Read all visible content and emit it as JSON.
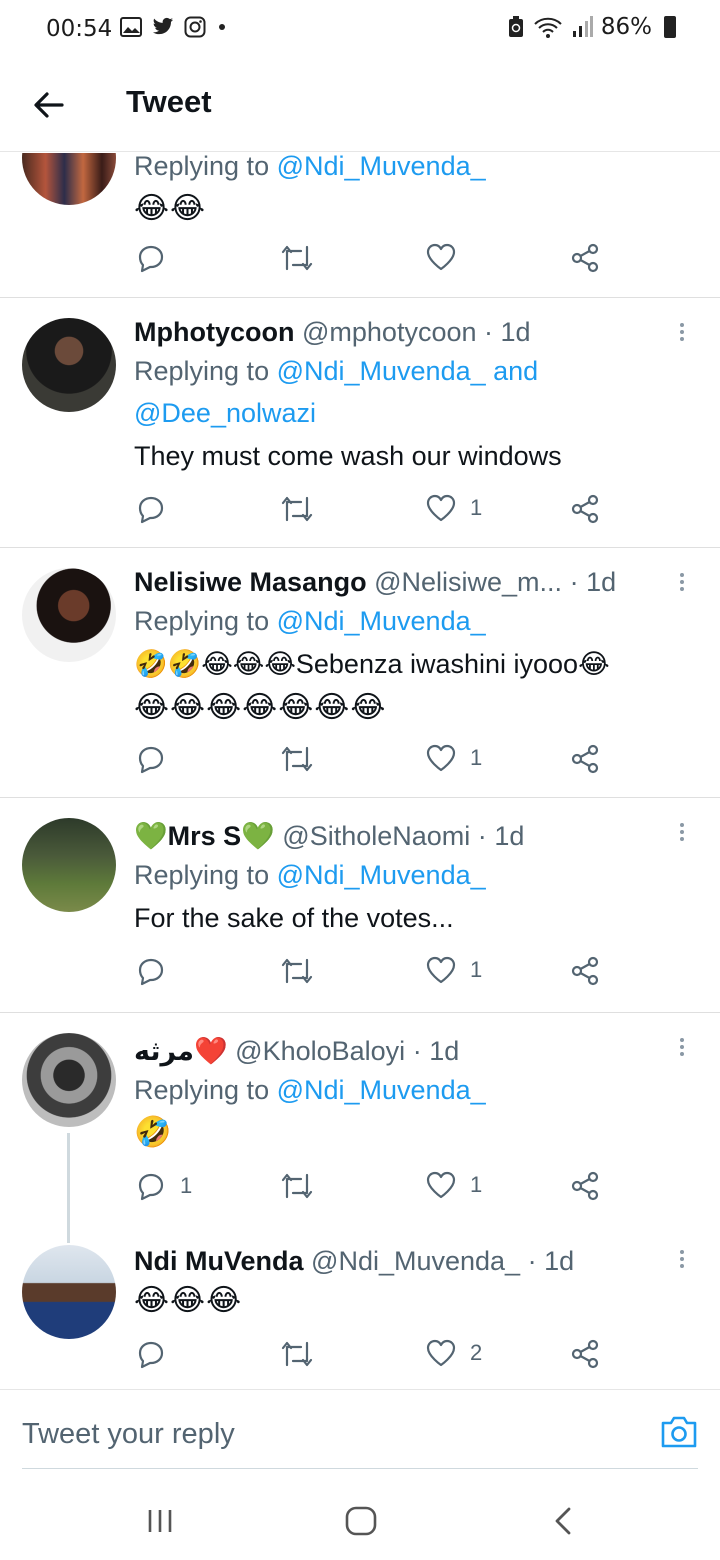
{
  "status_bar": {
    "time": "00:54",
    "battery": "86%",
    "left_icons": [
      "gallery-icon",
      "twitter-bird-icon",
      "instagram-icon",
      "dot-icon"
    ],
    "right_icons": [
      "recycle-icon",
      "wifi-icon",
      "signal-icon",
      "battery-icon"
    ]
  },
  "header": {
    "title": "Tweet"
  },
  "tweets": [
    {
      "name": "",
      "handle": "",
      "time": "",
      "replying_prefix": "Replying to ",
      "mentions": "@Ndi_Muvenda_",
      "text": "😂😂",
      "counts": {
        "reply": "",
        "retweet": "",
        "like": ""
      }
    },
    {
      "name": "Mphotycoon",
      "handle": "@mphotycoon",
      "sep": "·",
      "time": "1d",
      "replying_prefix": "Replying to ",
      "mentions": "@Ndi_Muvenda_ and",
      "mentions2": "@Dee_nolwazi",
      "text": "They must come wash our windows",
      "counts": {
        "reply": "",
        "retweet": "",
        "like": "1"
      }
    },
    {
      "name": "Nelisiwe Masango",
      "handle": "@Nelisiwe_m...",
      "sep": "·",
      "time": "1d",
      "replying_prefix": "Replying to ",
      "mentions": "@Ndi_Muvenda_",
      "text": "🤣🤣😂😂😂Sebenza iwashini iyooo😂",
      "text2": "😂😂😂😂😂😂😂",
      "counts": {
        "reply": "",
        "retweet": "",
        "like": "1"
      }
    },
    {
      "name": "💚Mrs S💚",
      "handle": "@SitholeNaomi",
      "sep": "·",
      "time": "1d",
      "replying_prefix": "Replying to ",
      "mentions": "@Ndi_Muvenda_",
      "text": "For the sake of the votes...",
      "counts": {
        "reply": "",
        "retweet": "",
        "like": "1"
      }
    },
    {
      "name": "مرثه❤️",
      "handle": "@KholoBaloyi",
      "sep": "·",
      "time": "1d",
      "replying_prefix": "Replying to ",
      "mentions": "@Ndi_Muvenda_",
      "text": "🤣",
      "counts": {
        "reply": "1",
        "retweet": "",
        "like": "1"
      }
    },
    {
      "name": "Ndi MuVenda",
      "handle": "@Ndi_Muvenda_",
      "sep": "·",
      "time": "1d",
      "text": "😂😂😂",
      "counts": {
        "reply": "",
        "retweet": "",
        "like": "2"
      }
    }
  ],
  "composer": {
    "placeholder": "Tweet your reply"
  },
  "colors": {
    "accent": "#1d9bf0",
    "secondary_text": "#536471",
    "primary_text": "#0f1419"
  }
}
